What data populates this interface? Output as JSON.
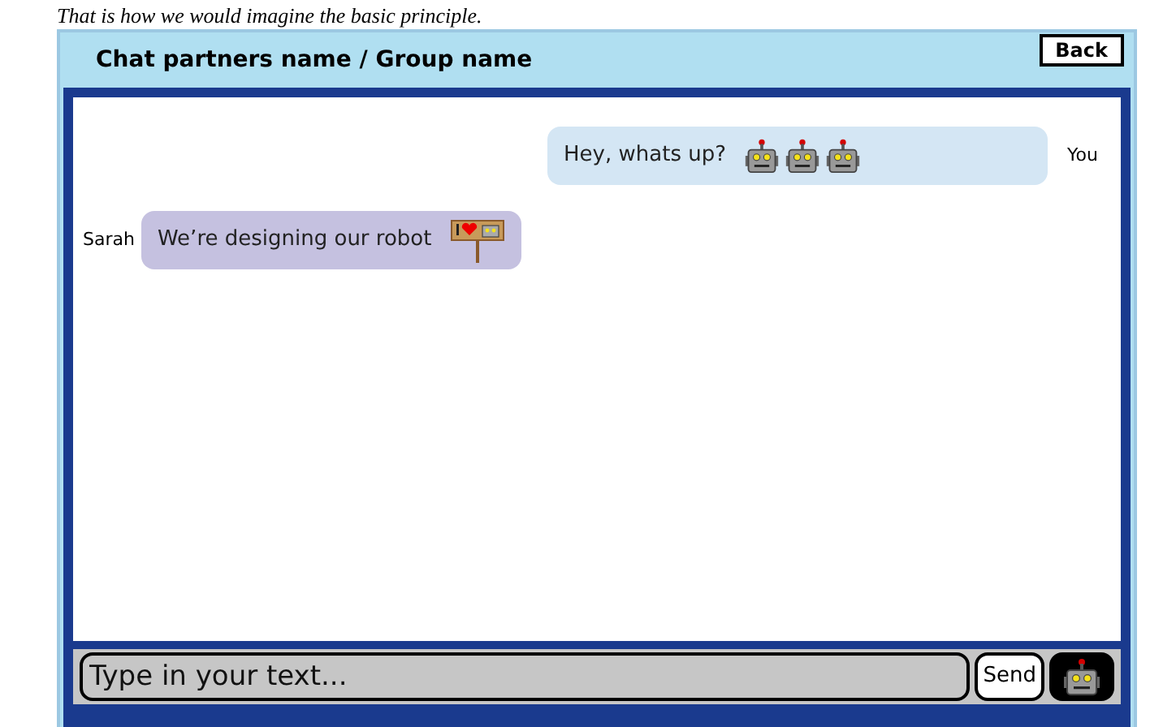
{
  "caption": "That is how we would imagine the basic principle.",
  "header": {
    "title": "Chat partners name / Group name",
    "back": "Back"
  },
  "messages": [
    {
      "sender": "You",
      "kind": "outgoing",
      "text": "Hey, whats up?",
      "stickers": [
        {
          "kind": "robot"
        },
        {
          "kind": "robot"
        },
        {
          "kind": "robot"
        }
      ]
    },
    {
      "sender": "Sarah",
      "kind": "incoming",
      "text": "We’re designing our robot",
      "stickers": [
        {
          "kind": "sign"
        }
      ]
    }
  ],
  "composer": {
    "placeholder": "Type in your text...",
    "send": "Send"
  }
}
